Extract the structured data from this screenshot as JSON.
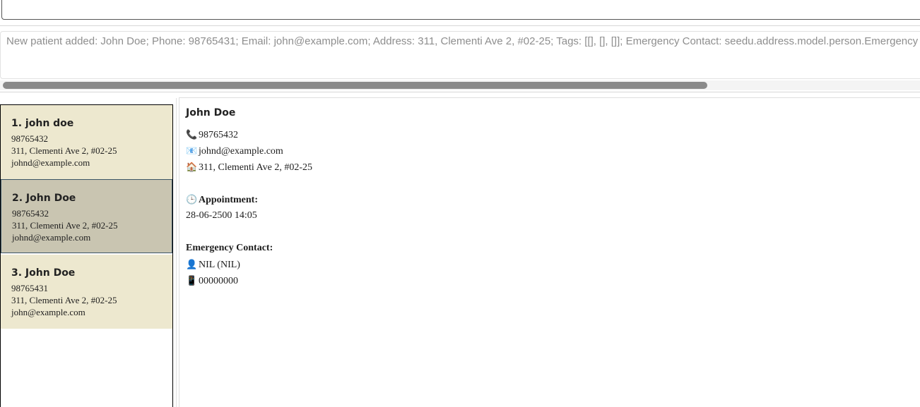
{
  "command_box": {
    "value": ""
  },
  "result": {
    "text": "New patient added: John Doe; Phone: 98765431; Email: john@example.com; Address: 311, Clementi Ave 2, #02-25; Tags: [[], [], []]; Emergency Contact: seedu.address.model.person.Emergency"
  },
  "patients": [
    {
      "name": "1. john doe",
      "phone": "98765432",
      "address": "311, Clementi Ave 2, #02-25",
      "email": "johnd@example.com"
    },
    {
      "name": "2. John Doe",
      "phone": "98765432",
      "address": "311, Clementi Ave 2, #02-25",
      "email": "johnd@example.com"
    },
    {
      "name": "3. John Doe",
      "phone": "98765431",
      "address": "311, Clementi Ave 2, #02-25",
      "email": "john@example.com"
    }
  ],
  "details": {
    "name": "John Doe",
    "phone_icon": "📞",
    "phone": "98765432",
    "email_icon": "📧",
    "email": "johnd@example.com",
    "address_icon": "🏠",
    "address": "311, Clementi Ave 2, #02-25",
    "appointment_icon": "🕒",
    "appointment_label": "Appointment:",
    "appointment": "28-06-2500 14:05",
    "emergency_label": "Emergency Contact:",
    "contact_icon": "👤",
    "emergency_name": "NIL  (NIL)",
    "contact_phone_icon": "📱",
    "emergency_phone": "00000000"
  },
  "colors": {
    "card_bg": "#ede8cf",
    "card_selected_bg": "#c9c5b1",
    "scroll_thumb": "#8a8a8a"
  }
}
